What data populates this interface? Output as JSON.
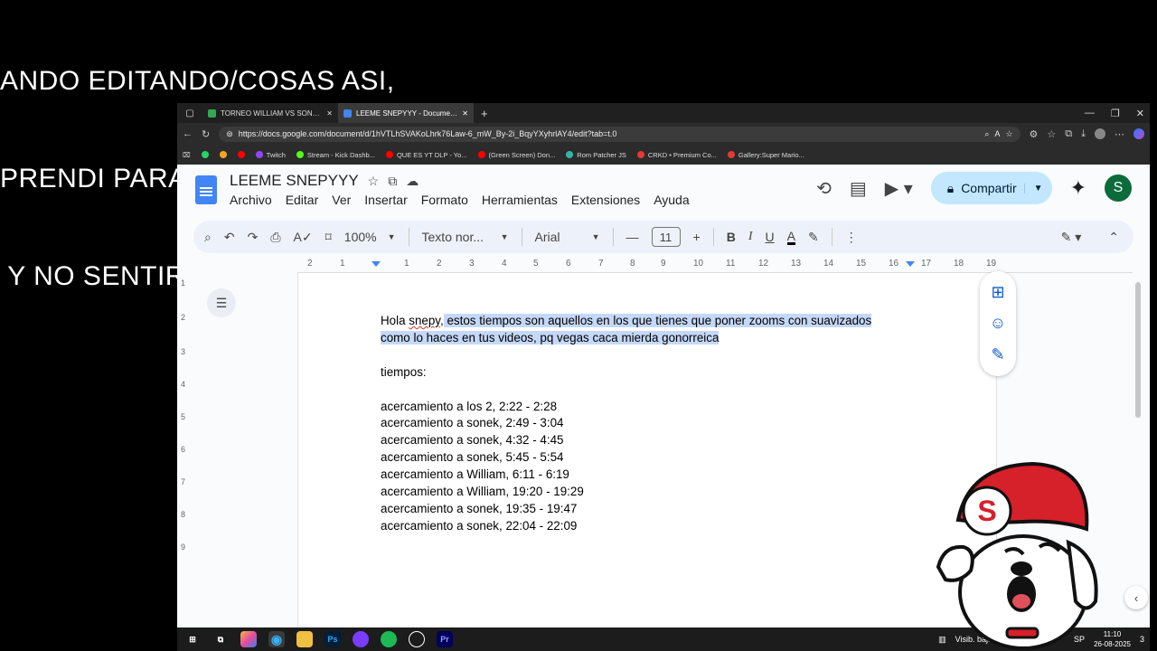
{
  "overlay": {
    "lines": [
      "ANDO EDITANDO/COSAS ASI,",
      "PRENDI PARA HABLAR CON ALGUIEN",
      " Y NO SENTIRME SOLITO UWU"
    ]
  },
  "browser": {
    "tabs": [
      {
        "title": "TORNEO WILLIAM VS SONEK - Goog",
        "active": false
      },
      {
        "title": "LEEME SNEPYYY - Documentos de",
        "active": true
      }
    ],
    "new_tab": "+",
    "url": "https://docs.google.com/document/d/1hVTLhSVAKoLhrk76Law-6_mW_By-2i_BqyYXyhrlAY4/edit?tab=t.0",
    "bookmarks": [
      {
        "label": "Twitch",
        "color": "#9146ff"
      },
      {
        "label": "Stream - Kick Dashb...",
        "color": "#53fc18"
      },
      {
        "label": "QUE ES YT DLP - Yo...",
        "color": "#ff0000"
      },
      {
        "label": "(Green Screen) Don...",
        "color": "#ff0000"
      },
      {
        "label": "Rom Patcher JS",
        "color": "#2fb7a8"
      },
      {
        "label": "CRKD • Premium Co...",
        "color": "#e53935"
      },
      {
        "label": "Gallery:Super Mario...",
        "color": "#e53935"
      }
    ]
  },
  "docs": {
    "title": "LEEME SNEPYYY",
    "menu": [
      "Archivo",
      "Editar",
      "Ver",
      "Insertar",
      "Formato",
      "Herramientas",
      "Extensiones",
      "Ayuda"
    ],
    "share_label": "Compartir",
    "avatar_letter": "S",
    "toolbar": {
      "zoom": "100%",
      "style": "Texto nor...",
      "font": "Arial",
      "size": "11"
    },
    "ruler_numbers": [
      "2",
      "1",
      "1",
      "2",
      "3",
      "4",
      "5",
      "6",
      "7",
      "8",
      "9",
      "10",
      "11",
      "12",
      "13",
      "14",
      "15",
      "16",
      "17",
      "18",
      "19"
    ],
    "left_ruler_numbers": [
      "1",
      "2",
      "3",
      "4",
      "5",
      "6",
      "7",
      "8",
      "9"
    ],
    "content": {
      "p1_plain": "Hola ",
      "p1_misspelled": "snepy",
      "p1_comma": ",",
      "p1_selected": " estos tiempos son aquellos en los que tienes que poner zooms con suavizados",
      "p2_selected": "como lo haces en tus videos, pq vegas caca mierda gonorreica",
      "heading": "tiempos:",
      "times": [
        "acercamiento a los 2, 2:22 - 2:28",
        "acercamiento a sonek, 2:49 - 3:04",
        "acercamiento a sonek, 4:32 - 4:45",
        "acercamiento a sonek, 5:45 - 5:54",
        "acercamiento a William, 6:11 - 6:19",
        "acercamiento a William, 19:20 - 19:29",
        "acercamiento a sonek, 19:35 - 19:47",
        "acercamiento a sonek, 22:04 - 22:09"
      ]
    }
  },
  "taskbar": {
    "apps": [
      "Ps",
      "Pr"
    ],
    "visibility": "Visib. baja",
    "lang": "SP",
    "time": "11:10",
    "date": "26-08-2025",
    "notif": "3"
  },
  "mascot": {
    "badge_letter": "S"
  }
}
